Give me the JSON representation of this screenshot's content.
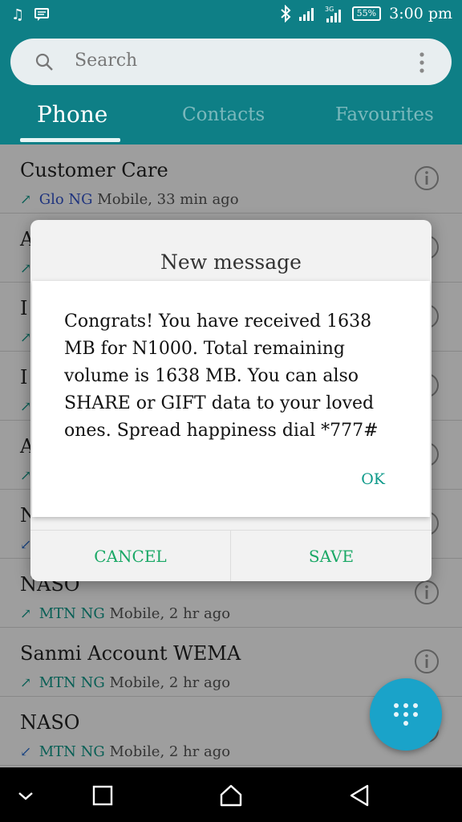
{
  "status": {
    "time": "3:00 pm",
    "battery": "55%",
    "icons": [
      "music-note-icon",
      "message-icon",
      "bluetooth-icon",
      "signal-icon",
      "signal-3g-icon",
      "battery-icon"
    ]
  },
  "search": {
    "placeholder": "Search"
  },
  "tabs": [
    {
      "label": "Phone",
      "active": true
    },
    {
      "label": "Contacts",
      "active": false
    },
    {
      "label": "Favourites",
      "active": false
    }
  ],
  "calls": [
    {
      "name": "Customer Care",
      "carrier": "Glo NG",
      "detail": " Mobile, 33 min ago",
      "direction": "outgoing"
    },
    {
      "name": "A",
      "carrier": "",
      "detail": "",
      "direction": "outgoing"
    },
    {
      "name": "I",
      "carrier": "",
      "detail": "",
      "direction": "outgoing"
    },
    {
      "name": "I",
      "carrier": "",
      "detail": "",
      "direction": "outgoing"
    },
    {
      "name": "A",
      "carrier": "",
      "detail": "",
      "direction": "outgoing"
    },
    {
      "name": "N",
      "carrier": "",
      "detail": "",
      "direction": "incoming"
    },
    {
      "name": "NASO",
      "carrier": "MTN NG",
      "detail": " Mobile, 2 hr ago",
      "direction": "outgoing"
    },
    {
      "name": "Sanmi Account WEMA",
      "carrier": "MTN NG",
      "detail": " Mobile, 2 hr ago",
      "direction": "outgoing"
    },
    {
      "name": "NASO",
      "carrier": "MTN NG",
      "detail": " Mobile, 2 hr ago",
      "direction": "incoming"
    }
  ],
  "dialog": {
    "title": "New message",
    "message": "Congrats! You have received 1638 MB for N1000. Total remaining volume is 1638 MB. You can also SHARE or GIFT data to your loved ones. Spread happiness dial *777#",
    "ok_label": "OK",
    "cancel_label": "CANCEL",
    "save_label": "SAVE"
  },
  "colors": {
    "teal": "#0e7f86",
    "accent_green": "#1aa866",
    "fab_blue": "#1aa3c9"
  }
}
